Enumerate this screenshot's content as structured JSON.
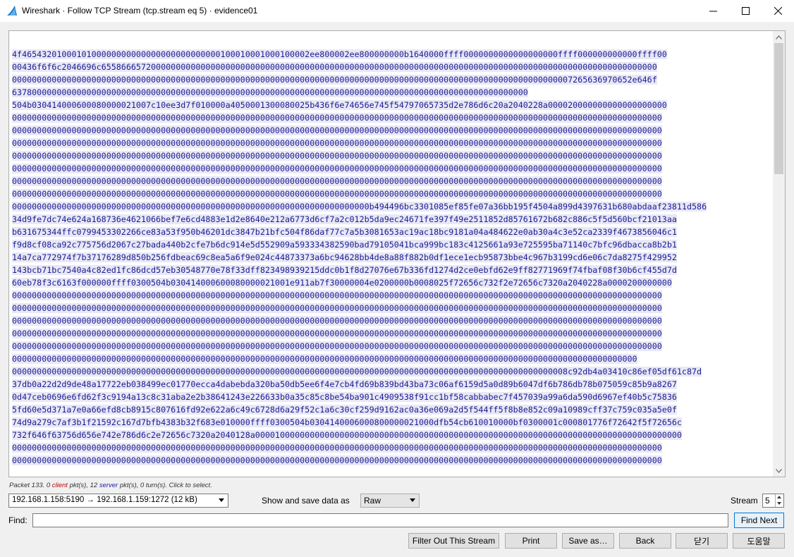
{
  "window": {
    "title": "Wireshark · Follow TCP Stream (tcp.stream eq 5) · evidence01",
    "icon": "wireshark-fin-icon"
  },
  "stream": {
    "lines": [
      "4f4654320100010100000000000000000000000000100010001000100002ee800002ee800000000b1640000ffff0000000000000000000ffff000000000000ffff00",
      "00436f6f6c2046696c6558666572000000000000000000000000000000000000000000000000000000000000000000000000000000000000000000000000000000",
      "00000000000000000000000000000000000000000000000000000000000000000000000000000000000000000000000000000000000000007265636970652e646f",
      "63780000000000000000000000000000000000000000000000000000000000000000000000000000000000000000000000000000",
      "504b030414000600080000021007c10ee3d7f010000a4050001300080025b436f6e74656e745f54797065735d2e786d6c20a2040228a000020000000000000000000",
      "00000000000000000000000000000000000000000000000000000000000000000000000000000000000000000000000000000000000000000000000000000000000",
      "00000000000000000000000000000000000000000000000000000000000000000000000000000000000000000000000000000000000000000000000000000000000",
      "00000000000000000000000000000000000000000000000000000000000000000000000000000000000000000000000000000000000000000000000000000000000",
      "00000000000000000000000000000000000000000000000000000000000000000000000000000000000000000000000000000000000000000000000000000000000",
      "00000000000000000000000000000000000000000000000000000000000000000000000000000000000000000000000000000000000000000000000000000000000",
      "00000000000000000000000000000000000000000000000000000000000000000000000000000000000000000000000000000000000000000000000000000000000",
      "00000000000000000000000000000000000000000000000000000000000000000000000000000000000000000000000000000000000000000000000000000000000",
      "000000000000000000000000000000000000000000000000000000000000000000000000b494496bc3301085ef85fe07a36bb195f4504a899d4397631b680abdaaf23811d586",
      "34d9fe7dc74e624a168736e4621066bef7e6cd4883e1d2e8640e212a6773d6cf7a2c012b5da9ec24671fe397f49e2511852d85761672b682c886c5f5d560bcf21013aa",
      "b631675344ffc0799453302266ce83a53f950b46201dc3847b21bfc504f86daf77c7a5b3081653ac19ac18bc9181a04a484622e0ab30a4c3e52ca2339f4673856046c1",
      "f9d8cf08ca92c775756d2067c27bada440b2cfe7b6dc914e5d552909a593334382590bad79105041bca999bc183c4125661a93e725595ba71140c7bfc96dbacca8b2b1",
      "14a7ca772974f7b37176289d850b256fdbeac69c8ea5a6f9e024c44873373a6bc94628bb4de8a88f882b0df1ece1ecb95873bbe4c967b3199cd6e06c7da8275f429952",
      "143bcb71bc7540a4c82ed1fc86dcd57eb30548770e78f33dff823498939215ddc0b1f8d27076e67b336fd1274d2ce0ebfd62e9ff82771969f74fbaf08f30b6cf455d7d",
      "60eb78f3c6163f000000ffff0300504b030414000600080000021001e911ab7f30000004e0200000b0008025f72656c732f2e72656c7320a2040228a0000200000000",
      "00000000000000000000000000000000000000000000000000000000000000000000000000000000000000000000000000000000000000000000000000000000000",
      "00000000000000000000000000000000000000000000000000000000000000000000000000000000000000000000000000000000000000000000000000000000000",
      "00000000000000000000000000000000000000000000000000000000000000000000000000000000000000000000000000000000000000000000000000000000000",
      "00000000000000000000000000000000000000000000000000000000000000000000000000000000000000000000000000000000000000000000000000000000000",
      "00000000000000000000000000000000000000000000000000000000000000000000000000000000000000000000000000000000000000000000000000000000000",
      "000000000000000000000000000000000000000000000000000000000000000000000000000000000000000000000000000000000000000000000000000000",
      "0000000000000000000000000000000000000000000000000000000000000000000000000000000000000000000000000000000000000008c92db4a03410c86ef05df61c87d",
      "37db0a22d2d9de48a17722eb038499ec01770ecca4dabebda320ba50db5ee6f4e7cb4fd69b839bd43ba73c06af6159d5a0d89b6047df6b786db78b075059c85b9a8267",
      "0d47ceb0696e6fd62f3c9194a13c8c31aba2e2b38641243e226633b0a35c85c8be54ba901c4909538f91cc1bf58cabbabec7f457039a99a6da590d6967ef40b5c75836",
      "5fd60e5d371a7e0a66efd8cb8915c807616fd92e622a6c49c6728d6a29f52c1a6c30cf259d9162ac0a36e069a2d5f544ff5f8b8e852c09a10989cff37c759c035a5e0f",
      "74d9a279c7af3b1f21592c167d7bfb4383b32f683e010000ffff0300504b0304140006000800000021000dfb54cb610010000bf0300001c000801776f72642f5f72656c",
      "732f646f63756d656e742e786d6c2e72656c7320a2040128a00001000000000000000000000000000000000000000000000000000000000000000000000000000000000",
      "00000000000000000000000000000000000000000000000000000000000000000000000000000000000000000000000000000000000000000000000000000000000",
      "00000000000000000000000000000000000000000000000000000000000000000000000000000000000000000000000000000000000000000000000000000000000"
    ]
  },
  "status": {
    "packet": "Packet 133.",
    "client_count": "0",
    "client_word": "client",
    "client_suffix": "pkt(s),",
    "server_count": "12",
    "server_word": "server",
    "server_suffix": "pkt(s), 0 turn(s). Click to select."
  },
  "controls": {
    "conversation": "192.168.1.158:5190 → 192.168.1.159:1272 (12 kB)",
    "show_label": "Show and save data as",
    "format": "Raw",
    "stream_label": "Stream",
    "stream_value": "5",
    "find_label": "Find:",
    "find_value": "",
    "find_next": "Find Next"
  },
  "buttons": {
    "filter_out": "Filter Out This Stream",
    "print": "Print",
    "save_as": "Save as…",
    "back": "Back",
    "close": "닫기",
    "help": "도움말"
  },
  "colors": {
    "server_text": "#1a1a8f",
    "server_highlight": "#e8e8f7",
    "client_word": "#c00000",
    "server_word": "#1c1cb5",
    "wireshark_blue": "#1679c5"
  }
}
